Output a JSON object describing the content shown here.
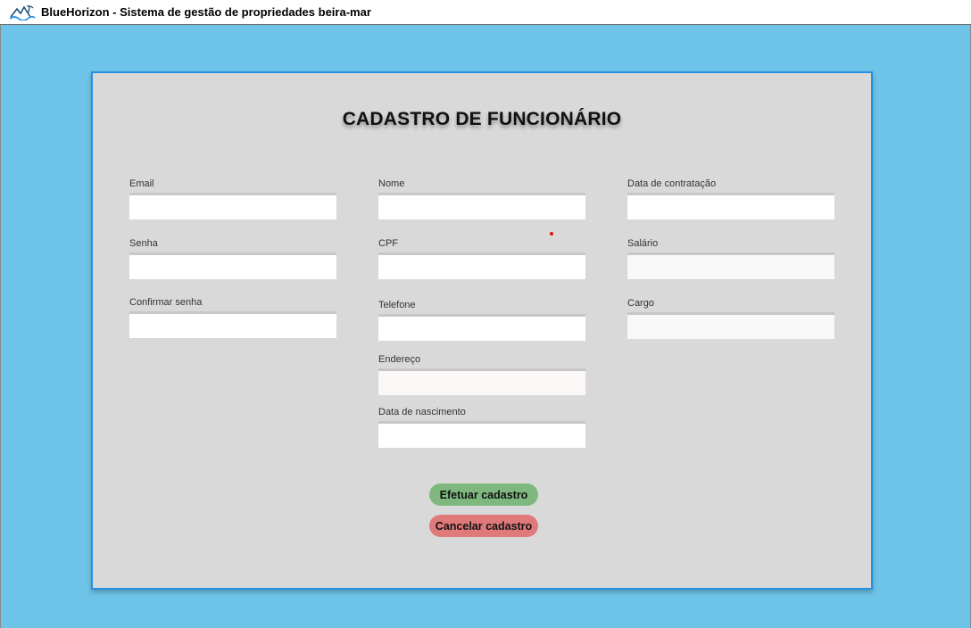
{
  "window": {
    "title": "BlueHorizon - Sistema de gestão de propriedades beira-mar",
    "logo_icon": "beach-waves-logo"
  },
  "form": {
    "heading": "CADASTRO DE FUNCIONÁRIO",
    "fields": {
      "email": {
        "label": "Email",
        "value": ""
      },
      "senha": {
        "label": "Senha",
        "value": ""
      },
      "confirmar_senha": {
        "label": "Confirmar senha",
        "value": ""
      },
      "nome": {
        "label": "Nome",
        "value": ""
      },
      "cpf": {
        "label": "CPF",
        "value": ""
      },
      "telefone": {
        "label": "Telefone",
        "value": ""
      },
      "endereco": {
        "label": "Endereço",
        "value": ""
      },
      "data_nascimento": {
        "label": "Data de nascimento",
        "value": ""
      },
      "data_contratacao": {
        "label": "Data de contratação",
        "value": ""
      },
      "salario": {
        "label": "Salário",
        "value": ""
      },
      "cargo": {
        "label": "Cargo",
        "value": ""
      }
    },
    "buttons": {
      "submit_label": "Efetuar cadastro",
      "cancel_label": "Cancelar cadastro"
    }
  },
  "colors": {
    "background": "#6ec4e8",
    "card": "#d9d9d9",
    "card_border": "#2a8fe0",
    "submit": "#7fb87f",
    "cancel": "#e07a7a"
  }
}
